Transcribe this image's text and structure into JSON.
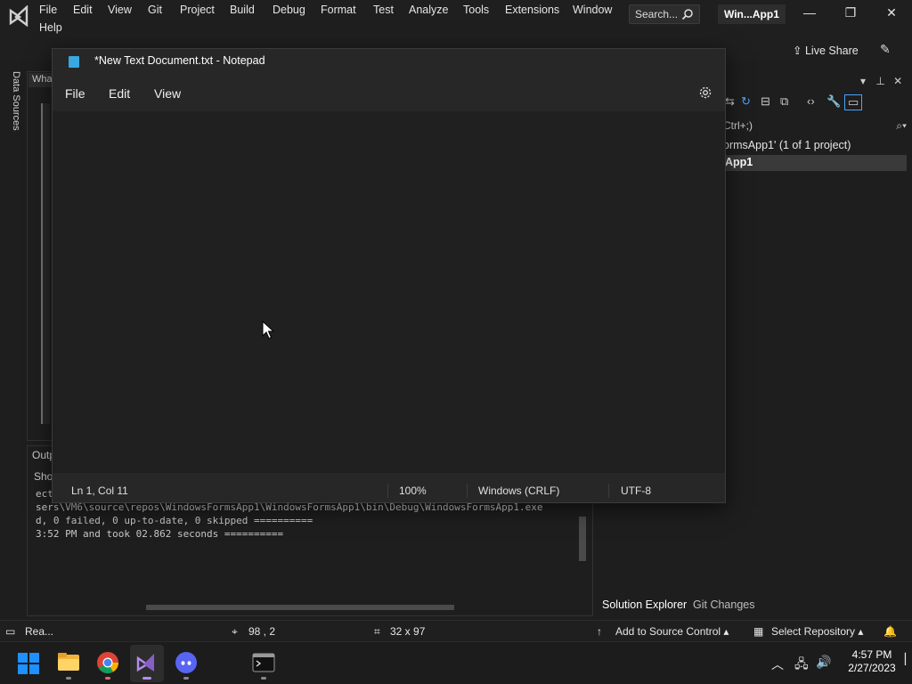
{
  "vs": {
    "menu": [
      "File",
      "Edit",
      "View",
      "Git",
      "Project",
      "Build",
      "Debug",
      "Format",
      "Test",
      "Analyze",
      "Tools",
      "Extensions",
      "Window",
      "Help"
    ],
    "search_label": "Search...",
    "solution_badge": "Win...App1",
    "live_share": "Live Share",
    "data_sources": "Data Sources",
    "editor_tab": "Wha",
    "output_tab": "Outp",
    "output_show": "Sho",
    "output_lines": [
      "ect",
      "sers\\VM6\\source\\repos\\WindowsFormsApp1\\WindowsFormsApp1\\bin\\Debug\\WindowsFormsApp1.exe",
      "d, 0 failed, 0 up-to-date, 0 skipped ==========",
      "3:52 PM and took 02.862 seconds =========="
    ],
    "solution": {
      "search": "Ctrl+;)",
      "root": "ormsApp1' (1 of 1 project)",
      "project": "App1",
      "tabs": [
        "Solution Explorer",
        "Git Changes"
      ]
    },
    "status": {
      "ready": "Rea...",
      "position": "98 , 2",
      "size": "32 x 97",
      "source_control": "Add to Source Control",
      "repository": "Select Repository"
    }
  },
  "notepad": {
    "title": "*New Text Document.txt - Notepad",
    "menu": [
      "File",
      "Edit",
      "View"
    ],
    "status": {
      "position": "Ln 1, Col 11",
      "zoom": "100%",
      "line_ending": "Windows (CRLF)",
      "encoding": "UTF-8"
    }
  },
  "taskbar": {
    "time": "4:57 PM",
    "date": "2/27/2023"
  },
  "colors": {
    "vs_purple": "#865fc5",
    "windows_blue": "#1e90ff",
    "discord": "#5865f2"
  }
}
